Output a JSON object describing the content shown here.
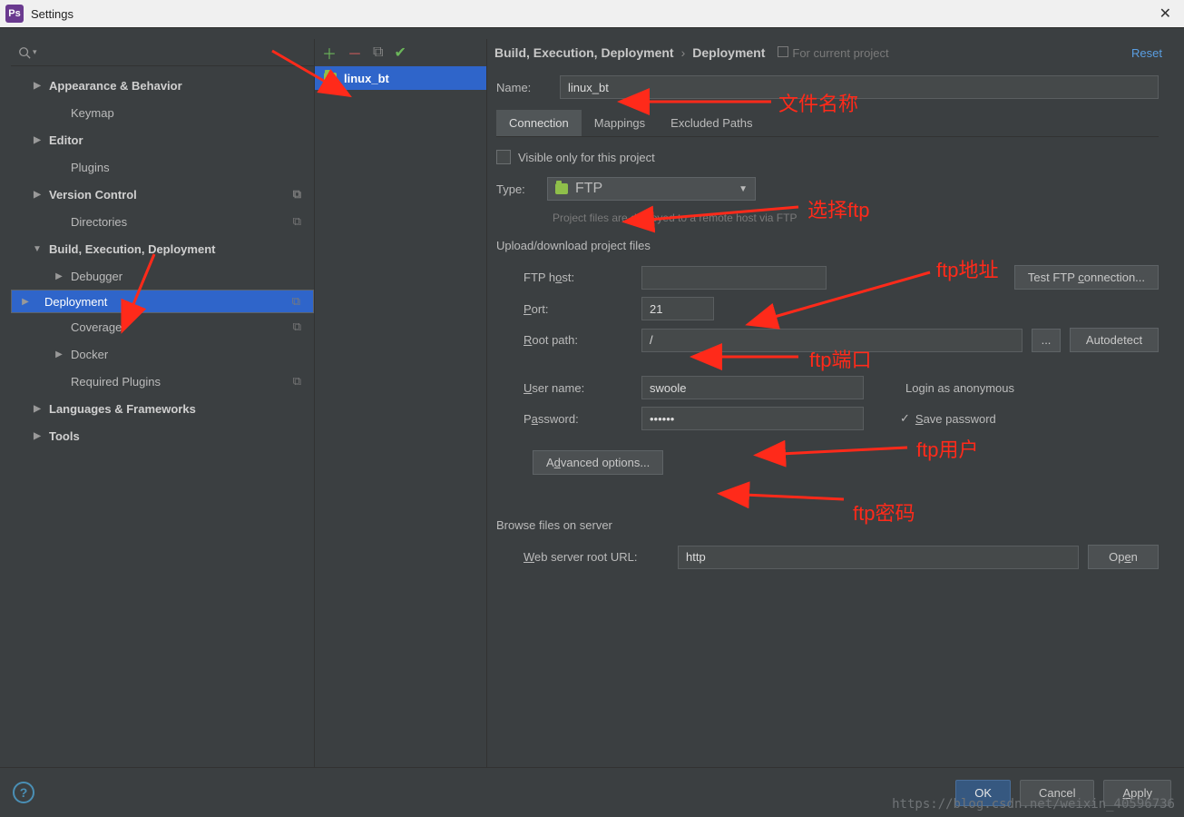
{
  "window": {
    "title": "Settings"
  },
  "breadcrumb": {
    "seg1": "Build, Execution, Deployment",
    "seg2": "Deployment",
    "hint": "For current project",
    "reset": "Reset"
  },
  "tree": {
    "items": [
      {
        "label": "Appearance & Behavior",
        "bold": true,
        "arrow": "▶",
        "lvl": 1
      },
      {
        "label": "Keymap",
        "bold": false,
        "arrow": "",
        "lvl": 2
      },
      {
        "label": "Editor",
        "bold": true,
        "arrow": "▶",
        "lvl": 1
      },
      {
        "label": "Plugins",
        "bold": false,
        "arrow": "",
        "lvl": 2
      },
      {
        "label": "Version Control",
        "bold": true,
        "arrow": "▶",
        "lvl": 1,
        "badge": "⧉"
      },
      {
        "label": "Directories",
        "bold": false,
        "arrow": "",
        "lvl": 2,
        "badge": "⧉"
      },
      {
        "label": "Build, Execution, Deployment",
        "bold": true,
        "arrow": "▼",
        "lvl": 1
      },
      {
        "label": "Debugger",
        "bold": false,
        "arrow": "▶",
        "lvl": 2
      },
      {
        "label": "Deployment",
        "bold": false,
        "arrow": "▶",
        "lvl": 2,
        "sel": true,
        "badge": "⧉"
      },
      {
        "label": "Coverage",
        "bold": false,
        "arrow": "",
        "lvl": 2,
        "badge": "⧉"
      },
      {
        "label": "Docker",
        "bold": false,
        "arrow": "▶",
        "lvl": 2
      },
      {
        "label": "Required Plugins",
        "bold": false,
        "arrow": "",
        "lvl": 2,
        "badge": "⧉"
      },
      {
        "label": "Languages & Frameworks",
        "bold": true,
        "arrow": "▶",
        "lvl": 1
      },
      {
        "label": "Tools",
        "bold": true,
        "arrow": "▶",
        "lvl": 1
      }
    ]
  },
  "servers": {
    "item": "linux_bt"
  },
  "form": {
    "name_label": "Name:",
    "name_value": "linux_bt",
    "tab1": "Connection",
    "tab2": "Mappings",
    "tab3": "Excluded Paths",
    "visible": "Visible only for this project",
    "type_label": "Type:",
    "type_value": "FTP",
    "type_hint": "Project files are deployed to a remote host via FTP",
    "section1": "Upload/download project files",
    "host_label": "FTP host:",
    "host_value": "",
    "test_btn": "Test FTP connection...",
    "port_label": "Port:",
    "port_value": "21",
    "root_label": "Root path:",
    "root_value": "/",
    "autodetect": "Autodetect",
    "user_label": "User name:",
    "user_value": "swoole",
    "anon": "Login as anonymous",
    "pwd_label": "Password:",
    "pwd_value": "••••••",
    "save_pwd": "Save password",
    "adv": "Advanced options...",
    "section2": "Browse files on server",
    "url_label": "Web server root URL:",
    "url_value": "http",
    "open": "Open"
  },
  "annotations": {
    "name": "文件名称",
    "type": "选择ftp",
    "host": "ftp地址",
    "port": "ftp端口",
    "user": "ftp用户",
    "pwd": "ftp密码"
  },
  "footer": {
    "ok": "OK",
    "cancel": "Cancel",
    "apply": "Apply"
  },
  "watermark": "https://blog.csdn.net/weixin_40596736"
}
